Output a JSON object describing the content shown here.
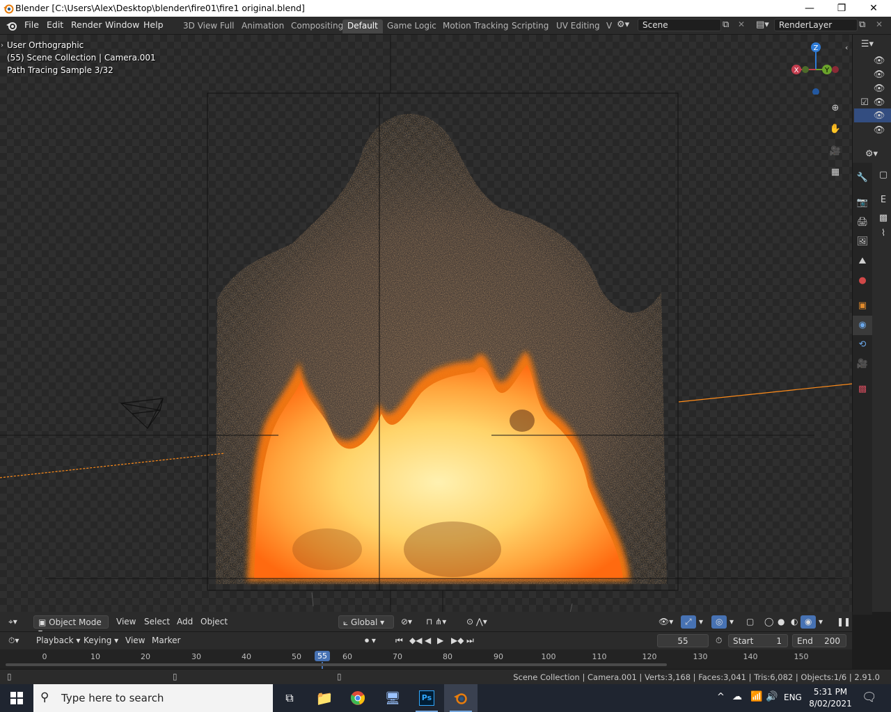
{
  "window": {
    "title": "Blender [C:\\Users\\Alex\\Desktop\\blender\\fire01\\fire1 original.blend]",
    "icons": {
      "minimize": "minimize-icon",
      "maximize": "restore-icon",
      "close": "close-icon"
    }
  },
  "menu": {
    "items": [
      "File",
      "Edit",
      "Render",
      "Window",
      "Help"
    ]
  },
  "workspaces": {
    "tabs": [
      "3D View Full",
      "Animation",
      "Compositing",
      "Default",
      "Game Logic",
      "Motion Tracking",
      "Scripting",
      "UV Editing",
      "V"
    ],
    "active": "Default"
  },
  "scene": {
    "label": "Scene",
    "render_layer": "RenderLayer"
  },
  "viewport": {
    "overlay_lines": [
      "User Orthographic",
      "(55) Scene Collection | Camera.001",
      "Path Tracing Sample 3/32"
    ],
    "gizmo": {
      "x": "X",
      "y": "Y",
      "z": "Z"
    }
  },
  "viewport_header": {
    "mode": "Object Mode",
    "menus": [
      "View",
      "Select",
      "Add",
      "Object"
    ],
    "orientation": "Global"
  },
  "timeline": {
    "menus": [
      "Playback",
      "Keying",
      "View",
      "Marker"
    ],
    "current_frame": "55",
    "start_label": "Start",
    "start": "1",
    "end_label": "End",
    "end": "200",
    "ticks": [
      "0",
      "10",
      "20",
      "30",
      "40",
      "50",
      "55",
      "60",
      "70",
      "80",
      "90",
      "100",
      "110",
      "120",
      "130",
      "140",
      "150"
    ]
  },
  "status": {
    "text": "Scene Collection | Camera.001 | Verts:3,168 | Faces:3,041 | Tris:6,082 | Objects:1/6 | 2.91.0"
  },
  "taskbar": {
    "search_placeholder": "Type here to search",
    "language": "ENG",
    "time": "5:31 PM",
    "date": "8/02/2021"
  },
  "colors": {
    "accent": "#4772b3",
    "fire_core": "#fff1b0",
    "fire_mid": "#ffb640",
    "fire_edge": "#ff6a10"
  }
}
